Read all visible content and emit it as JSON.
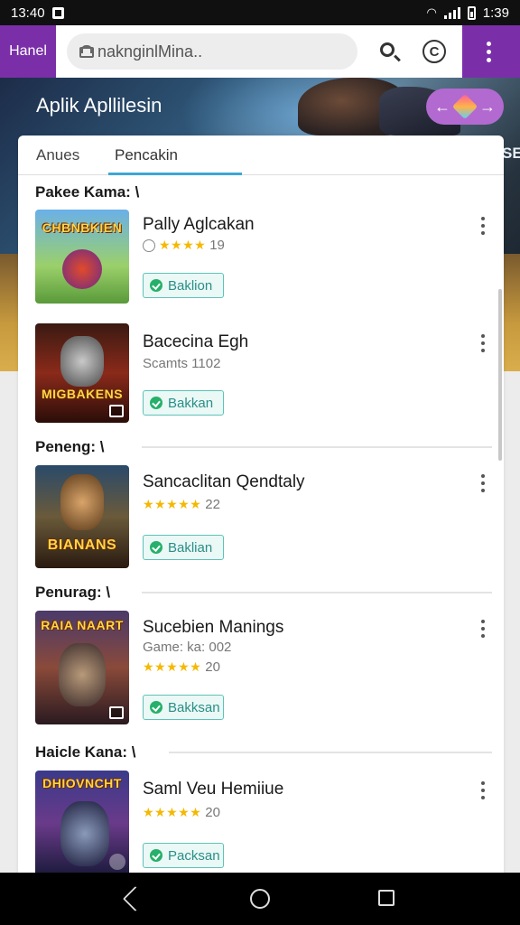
{
  "status_bar": {
    "time_left": "13:40",
    "time_right": "1:39"
  },
  "browser": {
    "tab_label": "Hanel",
    "url": "naknginlMina..",
    "refresh_glyph": "C",
    "icons": [
      "lock-icon",
      "search-icon",
      "refresh-icon",
      "more-vert-icon"
    ]
  },
  "hero": {
    "title": "Aplik Apllilesin",
    "side_text": "SE",
    "pill_left": "←",
    "pill_right": "→"
  },
  "tabs": [
    {
      "label": "Anues",
      "active": false
    },
    {
      "label": "Pencakin",
      "active": true
    }
  ],
  "sections": [
    {
      "title": "Pakee Kama: \\"
    },
    {
      "title": "Peneng: \\"
    },
    {
      "title": "Penurag: \\"
    },
    {
      "title": "Haicle Kana: \\"
    }
  ],
  "items": [
    {
      "name": "Pally Aglcakan",
      "sub": "★★★★ 19",
      "stars": "★★★★",
      "rating": "19",
      "button": "Baklion",
      "thumb_text": "CHBNBKIEN"
    },
    {
      "name": "Bacecina Egh",
      "sub": "Scamts 1102",
      "button": "Bakkan",
      "thumb_text": "MIGBAKENS"
    },
    {
      "name": "Sancaclitan Qendtaly",
      "stars": "★★★★★",
      "rating": "22",
      "button": "Baklian",
      "thumb_text": "BIANANS"
    },
    {
      "name": "Sucebien Manings",
      "sub": "Game: ka: 002",
      "stars": "★★★★★",
      "rating": "20",
      "button": "Bakksan",
      "thumb_text": "RAIA NAART"
    },
    {
      "name": "Saml Veu Hemiiue",
      "stars": "★★★★★",
      "rating": "20",
      "button": "Packsan",
      "thumb_text": "DHIOVNCHT"
    }
  ],
  "colors": {
    "browser_bar": "#7a2fa8",
    "tab_accent": "#3ea6d6",
    "button_border": "#5ec3b6",
    "star": "#f5b800"
  }
}
